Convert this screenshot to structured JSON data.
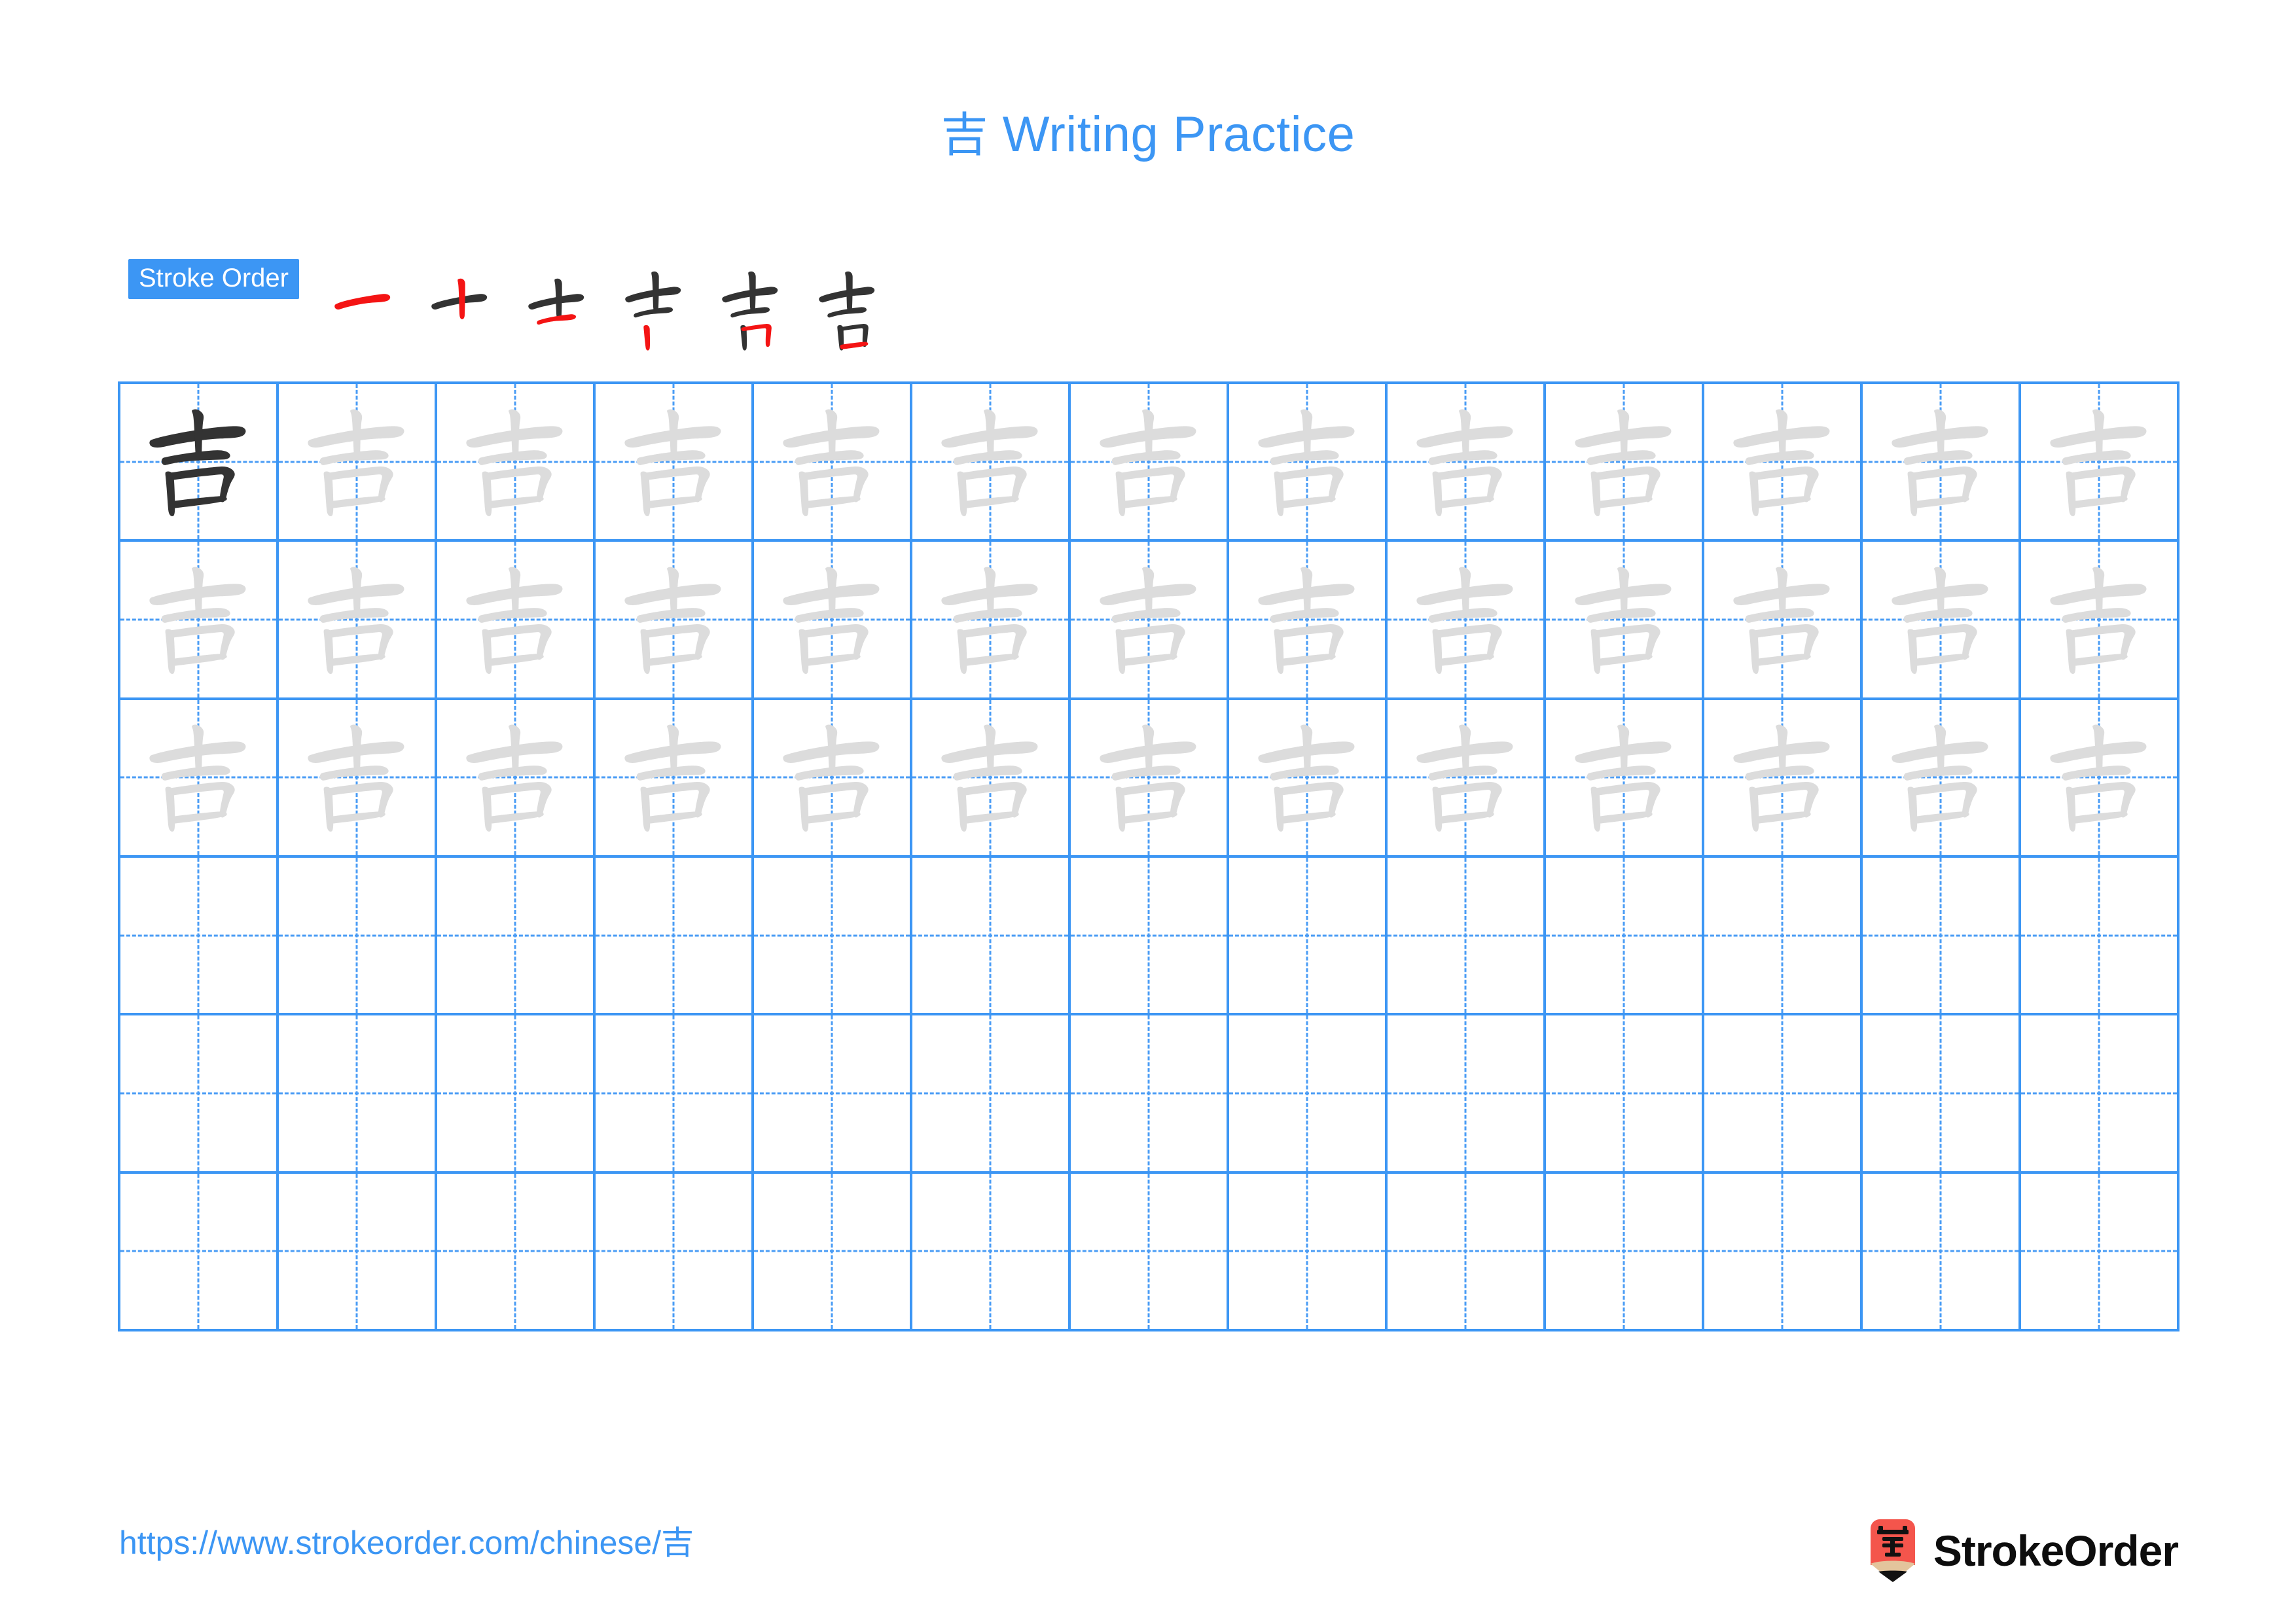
{
  "page": {
    "character": "吉",
    "title_suffix": " Writing Practice",
    "background_color": "#ffffff"
  },
  "colors": {
    "accent_blue": "#3c96f4",
    "grid_line": "#3c96f4",
    "grid_guide_dashed": "#4a9cf5",
    "ink_dark": "#333333",
    "ink_trace_gray": "#dcdcdc",
    "stroke_new_red": "#f41414",
    "stroke_old_black": "#333333",
    "logo_red": "#f4554c",
    "logo_wood": "#e3c49c",
    "logo_tip": "#111111",
    "brand_text": "#0d0d0d"
  },
  "stroke_order": {
    "label": "Stroke Order",
    "total_strokes": 6,
    "steps": [
      {
        "index": 1,
        "new_stroke": "heng (horizontal)",
        "strokes_shown": 1
      },
      {
        "index": 2,
        "new_stroke": "shu (vertical)",
        "strokes_shown": 2
      },
      {
        "index": 3,
        "new_stroke": "heng (horizontal base of 士)",
        "strokes_shown": 3
      },
      {
        "index": 4,
        "new_stroke": "shu (left vertical of 口)",
        "strokes_shown": 4
      },
      {
        "index": 5,
        "new_stroke": "heng-zhe (horizontal-turn of 口)",
        "strokes_shown": 5
      },
      {
        "index": 6,
        "new_stroke": "heng (bottom closing of 口)",
        "strokes_shown": 6
      }
    ]
  },
  "grid": {
    "columns": 13,
    "rows": 6,
    "rows_detail": [
      {
        "row": 1,
        "first_cell_style": "dark",
        "other_cells_style": "trace",
        "filled_count": 13
      },
      {
        "row": 2,
        "first_cell_style": "trace",
        "other_cells_style": "trace",
        "filled_count": 13
      },
      {
        "row": 3,
        "first_cell_style": "trace",
        "other_cells_style": "trace",
        "filled_count": 13
      },
      {
        "row": 4,
        "first_cell_style": "empty",
        "other_cells_style": "empty",
        "filled_count": 0
      },
      {
        "row": 5,
        "first_cell_style": "empty",
        "other_cells_style": "empty",
        "filled_count": 0
      },
      {
        "row": 6,
        "first_cell_style": "empty",
        "other_cells_style": "empty",
        "filled_count": 0
      }
    ]
  },
  "footer": {
    "url": "https://www.strokeorder.com/chinese/吉",
    "brand_name": "StrokeOrder",
    "brand_mark_character": "字"
  }
}
